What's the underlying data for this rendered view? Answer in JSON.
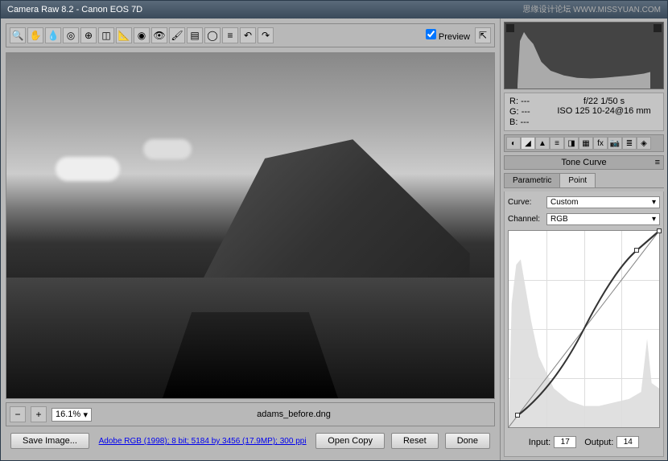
{
  "window": {
    "title": "Camera Raw 8.2  -  Canon EOS 7D"
  },
  "watermark": "思缘设计论坛  WWW.MISSYUAN.COM",
  "toolbar": {
    "preview_label": "Preview"
  },
  "zoom": {
    "value": "16.1%"
  },
  "file": {
    "name": "adams_before.dng"
  },
  "info_link": "Adobe RGB (1998); 8 bit; 5184 by 3456 (17.9MP); 300 ppi",
  "buttons": {
    "save_image": "Save Image...",
    "open_copy": "Open Copy",
    "reset": "Reset",
    "done": "Done"
  },
  "readout": {
    "r": "R:",
    "r_val": "---",
    "g": "G:",
    "g_val": "---",
    "b": "B:",
    "b_val": "---",
    "exposure": "f/22   1/50 s",
    "iso": "ISO 125   10-24@16 mm"
  },
  "panel": {
    "title": "Tone Curve"
  },
  "tabs": {
    "parametric": "Parametric",
    "point": "Point"
  },
  "curve": {
    "curve_label": "Curve:",
    "curve_value": "Custom",
    "channel_label": "Channel:",
    "channel_value": "RGB",
    "input_label": "Input:",
    "input_value": "17",
    "output_label": "Output:",
    "output_value": "14"
  }
}
